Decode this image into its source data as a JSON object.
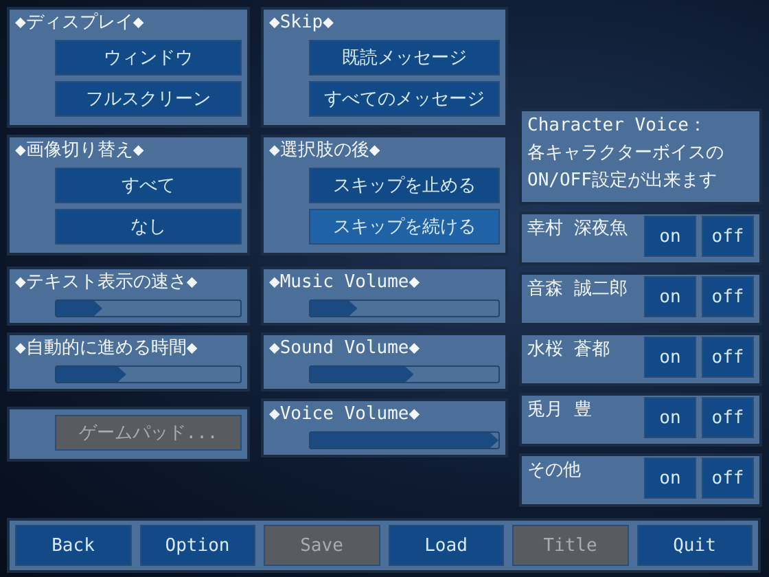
{
  "display": {
    "title": "◆ディスプレイ◆",
    "options": [
      {
        "label": "ウィンドウ",
        "selected": false,
        "disabled": false
      },
      {
        "label": "フルスクリーン",
        "selected": false,
        "disabled": false
      }
    ]
  },
  "skip": {
    "title": "◆Skip◆",
    "options": [
      {
        "label": "既読メッセージ",
        "selected": false,
        "disabled": false
      },
      {
        "label": "すべてのメッセージ",
        "selected": false,
        "disabled": false
      }
    ]
  },
  "image_switch": {
    "title": "◆画像切り替え◆",
    "options": [
      {
        "label": "すべて",
        "selected": false,
        "disabled": false
      },
      {
        "label": "なし",
        "selected": false,
        "disabled": false
      }
    ]
  },
  "after_choice": {
    "title": "◆選択肢の後◆",
    "options": [
      {
        "label": "スキップを止める",
        "selected": false,
        "disabled": false
      },
      {
        "label": "スキップを続ける",
        "selected": true,
        "disabled": false
      }
    ]
  },
  "left_sliders": [
    {
      "title": "◆テキスト表示の速さ◆",
      "level": 0.25
    },
    {
      "title": "◆自動的に進める時間◆",
      "level": 0.38
    }
  ],
  "gamepad": {
    "label": "ゲームパッド...",
    "disabled": true
  },
  "volume_sliders": [
    {
      "title": "◆Music Volume◆",
      "level": 0.25
    },
    {
      "title": "◆Sound Volume◆",
      "level": 0.55
    },
    {
      "title": "◆Voice Volume◆",
      "level": 1.0
    }
  ],
  "character_voice": {
    "title": "Character Voice：",
    "description": "各キャラクターボイスのON/OFF設定が出来ます",
    "characters": [
      {
        "name": "幸村 深夜魚",
        "on_label": "on",
        "off_label": "off"
      },
      {
        "name": "音森 誠二郎",
        "on_label": "on",
        "off_label": "off"
      },
      {
        "name": "水桜 蒼都",
        "on_label": "on",
        "off_label": "off"
      },
      {
        "name": "兎月 豊",
        "on_label": "on",
        "off_label": "off"
      },
      {
        "name": "その他",
        "on_label": "on",
        "off_label": "off"
      }
    ]
  },
  "bottom_bar": [
    {
      "label": "Back",
      "disabled": false
    },
    {
      "label": "Option",
      "disabled": false
    },
    {
      "label": "Save",
      "disabled": true
    },
    {
      "label": "Load",
      "disabled": false
    },
    {
      "label": "Title",
      "disabled": true
    },
    {
      "label": "Quit",
      "disabled": false
    }
  ]
}
